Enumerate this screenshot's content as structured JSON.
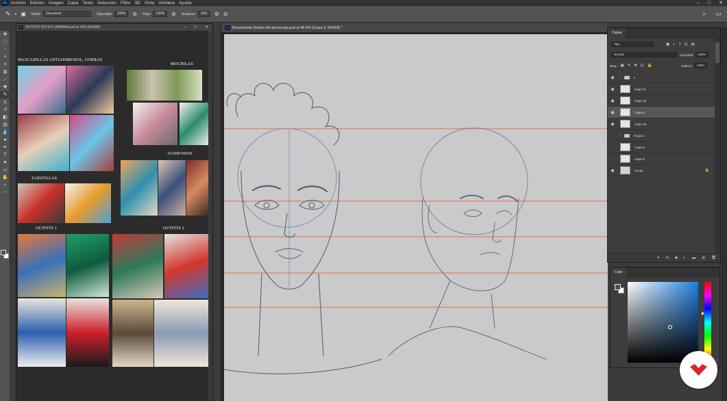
{
  "menubar": {
    "items": [
      "Archivo",
      "Edición",
      "Imagen",
      "Capa",
      "Texto",
      "Selección",
      "Filtro",
      "3D",
      "Vista",
      "Ventana",
      "Ayuda"
    ]
  },
  "options_bar": {
    "mode_label": "Modo:",
    "mode_value": "Oscurecer",
    "opacity_label": "Opacidad:",
    "opacity_value": "100%",
    "flow_label": "Flujo:",
    "flow_value": "100%",
    "smoothing_label": "Suavizar:",
    "smoothing_value": "10%"
  },
  "doc_left": {
    "title": "OUTFITS ESTILO URBANA.psd al 14% (RGB/8)",
    "sections": {
      "masks": "MASCARILLAS  ANTIAERROSOL, GORRAS",
      "backpacks": "MOCHILAS",
      "headphones": "AUDIFONOS",
      "shoes": "ZAPATILLAS",
      "outfits1": "OUTFITS 1",
      "outfits2": "OUTFITS 2"
    }
  },
  "doc_main": {
    "title": "Bocetoando Rostro del personaje.psd al 48.6% (Capa 9, RGB/8) *"
  },
  "layers_panel": {
    "tab": "Capas",
    "filter_label": "Tipo",
    "blend_mode": "Normal",
    "opacity_label": "Opacidad:",
    "opacity_value": "100%",
    "lock_label": "Bloq.:",
    "fill_label": "Relleno:",
    "fill_value": "100%",
    "layers": [
      {
        "name": "1",
        "kind": "group",
        "visible": true
      },
      {
        "name": "Capa 11",
        "kind": "layer",
        "visible": true
      },
      {
        "name": "Capa 12",
        "kind": "layer",
        "visible": true
      },
      {
        "name": "Capa 9",
        "kind": "layer",
        "visible": true,
        "selected": true
      },
      {
        "name": "Capa 10",
        "kind": "layer",
        "visible": true
      },
      {
        "name": "Grupo 1",
        "kind": "group",
        "visible": false
      },
      {
        "name": "Capa 5",
        "kind": "layer",
        "visible": false
      },
      {
        "name": "Capa 6",
        "kind": "layer",
        "visible": false
      },
      {
        "name": "Fondo",
        "kind": "background",
        "visible": true,
        "locked": true
      }
    ]
  },
  "color_panel": {
    "tab": "Color",
    "foreground": "#3a556e",
    "background": "#ffffff"
  },
  "colors": {
    "guide_line": "#e4714f",
    "sketch_stroke": "#4f6376",
    "canvas_bg": "#cacaca"
  }
}
